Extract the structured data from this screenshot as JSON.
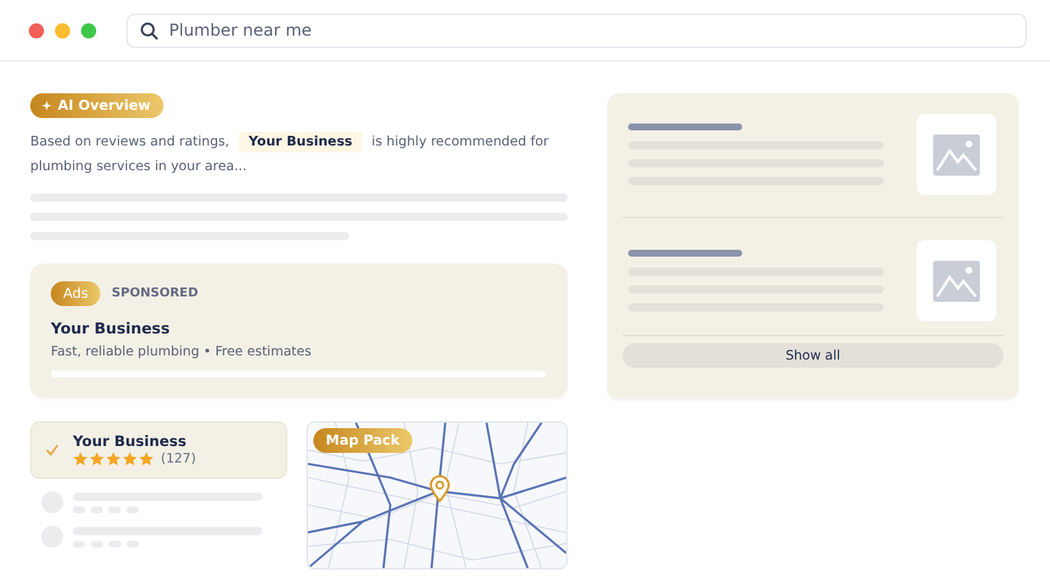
{
  "search": {
    "value": "Plumber near me"
  },
  "ai_overview": {
    "badge": "AI Overview",
    "text": "Based on reviews and ratings, **Your Business** is highly recommended for plumbing services in your area..."
  },
  "ad": {
    "badge": "Ads",
    "label": "SPONSORED",
    "title": "Your Business",
    "description": "Fast, reliable plumbing • Free estimates"
  },
  "listing": {
    "title": "Your Business",
    "stars": 5,
    "reviews": "(127)",
    "checked": true
  },
  "map": {
    "badge": "Map Pack",
    "kind": "picture"
  },
  "results_panel": {
    "button": "Show all"
  }
}
